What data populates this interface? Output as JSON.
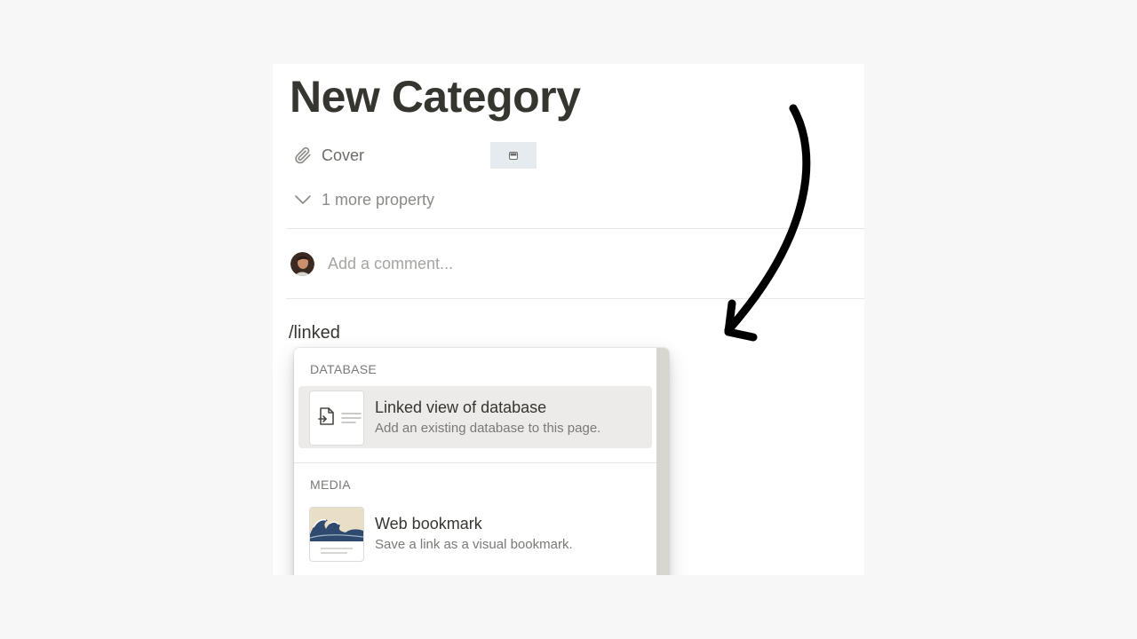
{
  "page": {
    "title": "New Category",
    "properties": [
      {
        "label": "Cover",
        "icon": "paperclip-icon"
      }
    ],
    "more_properties_label": "1 more property",
    "comment_placeholder": "Add a comment...",
    "typed_command": "/linked"
  },
  "menu": {
    "sections": [
      {
        "header": "DATABASE",
        "items": [
          {
            "title": "Linked view of database",
            "description": "Add an existing database to this page.",
            "icon": "linked-database-icon",
            "selected": true
          }
        ]
      },
      {
        "header": "MEDIA",
        "items": [
          {
            "title": "Web bookmark",
            "description": "Save a link as a visual bookmark.",
            "icon": "wave-image-icon",
            "selected": false
          }
        ]
      }
    ]
  },
  "colors": {
    "page_background": "#f7f7f7",
    "text_primary": "#37352f",
    "selected_item": "#ecebea",
    "cover_swatch": "#e6ebf0",
    "annotation_arrow": "#000000"
  }
}
